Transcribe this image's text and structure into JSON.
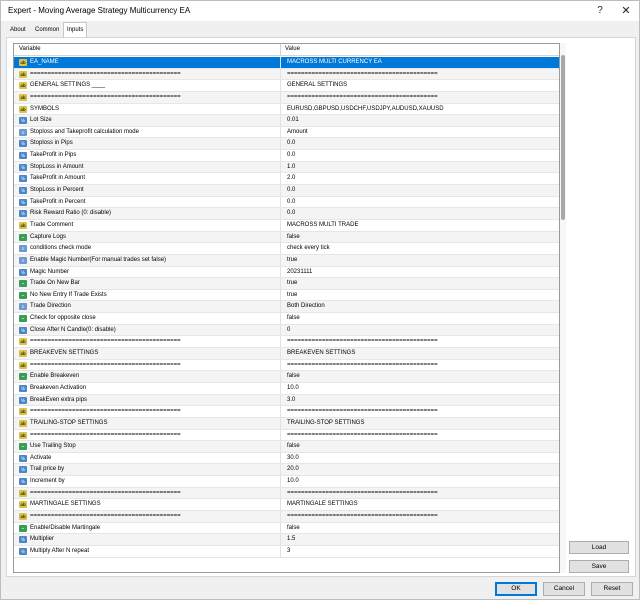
{
  "window": {
    "title": "Expert - Moving Average Strategy Multicurrency EA",
    "help_label": "?",
    "close_label": "✕"
  },
  "tabs": [
    {
      "label": "About"
    },
    {
      "label": "Common"
    },
    {
      "label": "Inputs"
    }
  ],
  "grid": {
    "headers": {
      "variable": "Variable",
      "value": "Value"
    },
    "rows": [
      {
        "icon": "ab",
        "name": "EA_NAME",
        "value": "MACROSS MULTI CURRENCY EA",
        "selected": true
      },
      {
        "icon": "ab",
        "name": "===========================================",
        "value": "==========================================="
      },
      {
        "icon": "ab",
        "name": "GENERAL SETTINGS ____",
        "value": "GENERAL SETTINGS"
      },
      {
        "icon": "ab",
        "name": "===========================================",
        "value": "==========================================="
      },
      {
        "icon": "ab",
        "name": "SYMBOLS",
        "value": "EURUSD,GBPUSD,USDCHF,USDJPY,AUDUSD,XAUUSD"
      },
      {
        "icon": "num",
        "name": "Lot Size",
        "value": "0.01"
      },
      {
        "icon": "list",
        "name": "Stoploss and Takeprofit calculation mode",
        "value": "Amount"
      },
      {
        "icon": "num",
        "name": "Stoploss in Pips",
        "value": "0.0"
      },
      {
        "icon": "num",
        "name": "TakeProfit in Pips",
        "value": "0.0"
      },
      {
        "icon": "num",
        "name": "StopLoss in Amount",
        "value": "1.0"
      },
      {
        "icon": "num",
        "name": "TakeProfit in Amount",
        "value": "2.0"
      },
      {
        "icon": "num",
        "name": "StopLoss in Percent",
        "value": "0.0"
      },
      {
        "icon": "num",
        "name": "TakeProfit in Percent",
        "value": "0.0"
      },
      {
        "icon": "num",
        "name": "Risk Reward Ratio (0: disable)",
        "value": "0.0"
      },
      {
        "icon": "ab",
        "name": "Trade Comment",
        "value": "MACROSS MULTI TRADE"
      },
      {
        "icon": "bool",
        "name": "Capture Logs",
        "value": "false"
      },
      {
        "icon": "list",
        "name": "conditions check mode",
        "value": "check every tick"
      },
      {
        "icon": "list",
        "name": "Enable Magic Number(For manual trades set false)",
        "value": "true"
      },
      {
        "icon": "num",
        "name": "Magic Number",
        "value": "20231111"
      },
      {
        "icon": "bool",
        "name": "Trade On New Bar",
        "value": "true"
      },
      {
        "icon": "bool",
        "name": "No New Entry If Trade Exists",
        "value": "true"
      },
      {
        "icon": "list",
        "name": "Trade Direction",
        "value": "Both Direction"
      },
      {
        "icon": "bool",
        "name": "Check for opposite close",
        "value": "false"
      },
      {
        "icon": "num",
        "name": "Close After N Candle(0: disable)",
        "value": "0"
      },
      {
        "icon": "ab",
        "name": "===========================================",
        "value": "==========================================="
      },
      {
        "icon": "ab",
        "name": "BREAKEVEN SETTINGS",
        "value": "BREAKEVEN SETTINGS"
      },
      {
        "icon": "ab",
        "name": "===========================================",
        "value": "==========================================="
      },
      {
        "icon": "bool",
        "name": "Enable Breakeven",
        "value": "false"
      },
      {
        "icon": "num",
        "name": "Breakeven Activation",
        "value": "10.0"
      },
      {
        "icon": "num",
        "name": "BreakEven extra pips",
        "value": "3.0"
      },
      {
        "icon": "ab",
        "name": "===========================================",
        "value": "==========================================="
      },
      {
        "icon": "ab",
        "name": "TRAILING-STOP SETTINGS",
        "value": "TRAILING-STOP SETTINGS"
      },
      {
        "icon": "ab",
        "name": "===========================================",
        "value": "==========================================="
      },
      {
        "icon": "bool",
        "name": "Use Trailing Stop",
        "value": "false"
      },
      {
        "icon": "num",
        "name": "Activate",
        "value": "30.0"
      },
      {
        "icon": "num",
        "name": "Trail price by",
        "value": "20.0"
      },
      {
        "icon": "num",
        "name": "Increment by",
        "value": "10.0"
      },
      {
        "icon": "ab",
        "name": "===========================================",
        "value": "==========================================="
      },
      {
        "icon": "ab",
        "name": "MARTINGALE SETTINGS",
        "value": "MARTINGALE SETTINGS"
      },
      {
        "icon": "ab",
        "name": "===========================================",
        "value": "==========================================="
      },
      {
        "icon": "bool",
        "name": "Enable/Disable Martingale",
        "value": "false"
      },
      {
        "icon": "num",
        "name": "Multiplier",
        "value": "1.5"
      },
      {
        "icon": "num",
        "name": "Multiply After N repeat",
        "value": "3"
      }
    ]
  },
  "icon_glyphs": {
    "ab": "ab",
    "num": "½",
    "list": "≡",
    "bool": "~"
  },
  "buttons": {
    "load": "Load",
    "save": "Save",
    "ok": "OK",
    "cancel": "Cancel",
    "reset": "Reset"
  },
  "colors": {
    "selection": "#0078d7"
  }
}
